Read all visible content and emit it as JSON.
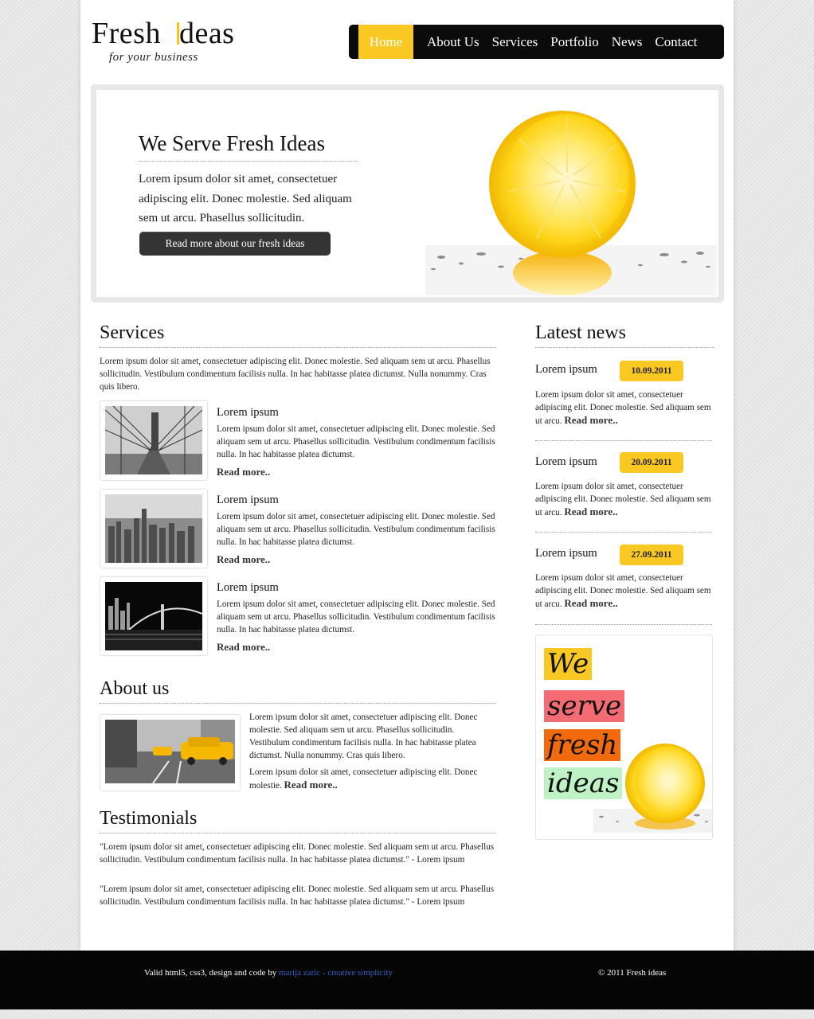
{
  "logo": {
    "main_a": "Fresh ",
    "main_b": "deas",
    "tagline": "for your business"
  },
  "nav": [
    "Home",
    "About Us",
    "Services",
    "Portfolio",
    "News",
    "Contact"
  ],
  "hero": {
    "title": "We Serve Fresh Ideas",
    "text": "Lorem ipsum dolor sit amet, consectetuer adipiscing elit. Donec molestie. Sed aliquam sem ut arcu. Phasellus sollicitudin.",
    "button": "Read more about our fresh ideas"
  },
  "services": {
    "heading": "Services",
    "intro": "Lorem ipsum dolor sit amet, consectetuer adipiscing elit. Donec molestie. Sed aliquam sem ut arcu. Phasellus sollicitudin. Vestibulum condimentum facilisis nulla. In hac habitasse platea dictumst. Nulla nonummy. Cras quis libero.",
    "items": [
      {
        "title": "Lorem ipsum",
        "text": "Lorem ipsum dolor sit amet, consectetuer adipiscing elit. Donec molestie. Sed aliquam sem ut arcu. Phasellus sollicitudin. Vestibulum condimentum facilisis nulla. In hac habitasse platea dictumst.",
        "more": "Read more.."
      },
      {
        "title": "Lorem ipsum",
        "text": "Lorem ipsum dolor sit amet, consectetuer adipiscing elit. Donec molestie. Sed aliquam sem ut arcu. Phasellus sollicitudin. Vestibulum condimentum facilisis nulla. In hac habitasse platea dictumst.",
        "more": "Read more.."
      },
      {
        "title": "Lorem ipsum",
        "text": "Lorem ipsum dolor sit amet, consectetuer adipiscing elit. Donec molestie. Sed aliquam sem ut arcu. Phasellus sollicitudin. Vestibulum condimentum facilisis nulla. In hac habitasse platea dictumst.",
        "more": "Read more.."
      }
    ]
  },
  "about": {
    "heading": "About us",
    "p1": "Lorem ipsum dolor sit amet, consectetuer adipiscing elit. Donec molestie. Sed aliquam sem ut arcu. Phasellus sollicitudin. Vestibulum condimentum facilisis nulla. In hac habitasse platea dictumst. Nulla nonummy. Cras quis libero.",
    "p2": "Lorem ipsum dolor sit amet, consectetuer adipiscing elit. Donec molestie.",
    "more": "Read more.."
  },
  "testimonials": {
    "heading": "Testimonials",
    "items": [
      "\"Lorem ipsum dolor sit amet, consectetuer adipiscing elit. Donec molestie. Sed aliquam sem ut arcu. Phasellus sollicitudin. Vestibulum condimentum facilisis nulla. In hac habitasse platea dictumst.\" - Lorem ipsum",
      "\"Lorem ipsum dolor sit amet, consectetuer adipiscing elit. Donec molestie. Sed aliquam sem ut arcu. Phasellus sollicitudin. Vestibulum condimentum facilisis nulla. In hac habitasse platea dictumst.\" - Lorem ipsum"
    ]
  },
  "news": {
    "heading": "Latest news",
    "items": [
      {
        "title": "Lorem ipsum",
        "date": "10.09.2011",
        "text": "Lorem ipsum dolor sit amet, consectetuer adipiscing elit. Donec molestie. Sed aliquam sem ut arcu.",
        "more": "Read more.."
      },
      {
        "title": "Lorem ipsum",
        "date": "20.09.2011",
        "text": "Lorem ipsum dolor sit amet, consectetuer adipiscing elit. Donec molestie. Sed aliquam sem ut arcu.",
        "more": "Read more.."
      },
      {
        "title": "Lorem ipsum",
        "date": "27.09.2011",
        "text": "Lorem ipsum dolor sit amet, consectetuer adipiscing elit. Donec molestie. Sed aliquam sem ut arcu.",
        "more": "Read more.."
      }
    ]
  },
  "promo": {
    "w1": "We",
    "w2": "serve",
    "w3": "fresh",
    "w4": "ideas"
  },
  "footer": {
    "left_text": "Valid html5, css3, design and code by ",
    "left_link": "marija zaric - creative simplicity",
    "right_text": "© 2011 Fresh ideas"
  },
  "colors": {
    "accent": "#f9c823",
    "nav_bg": "#0b0b0b",
    "promo_pink": "#f36b73",
    "promo_orange": "#f26a0e",
    "promo_green": "#bff2c4"
  }
}
